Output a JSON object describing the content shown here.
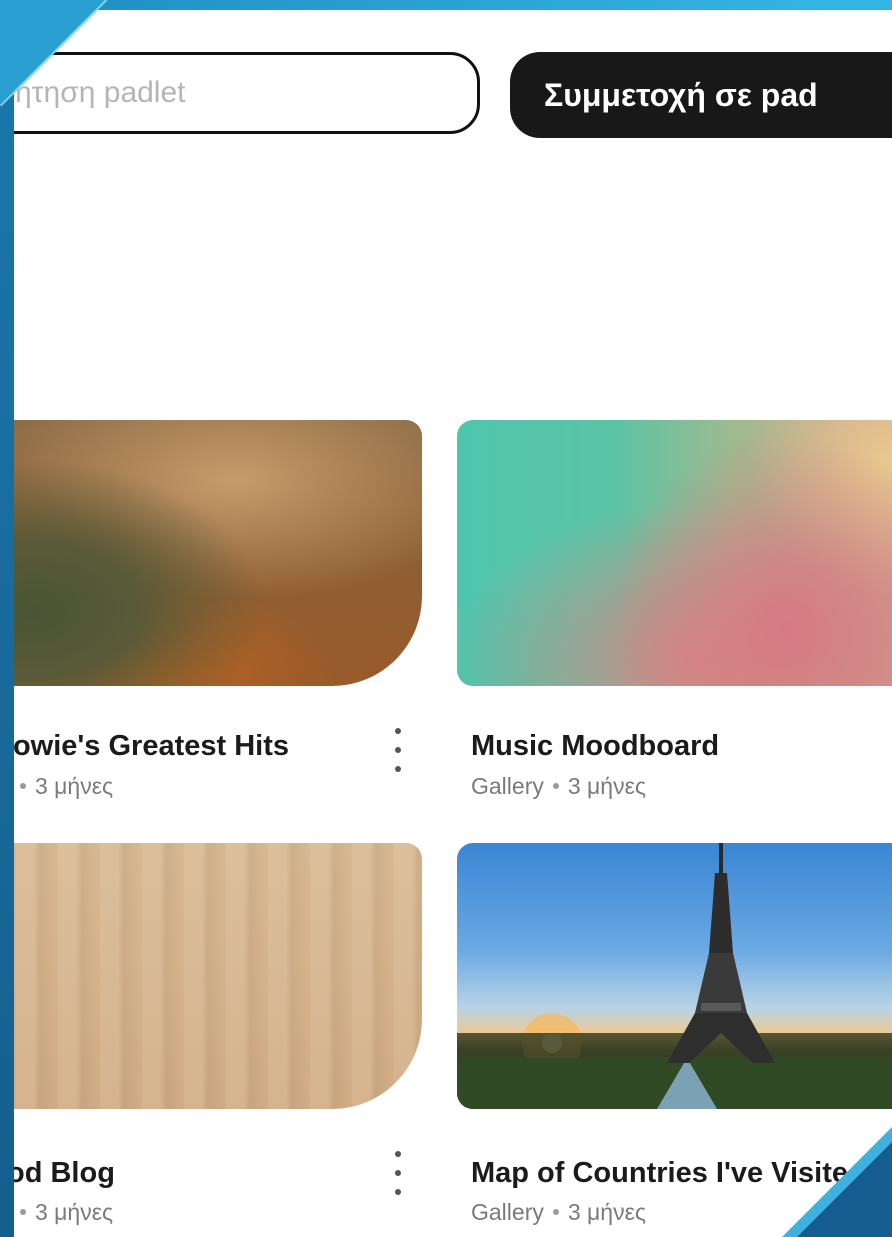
{
  "search": {
    "placeholder": "ήτηση padlet"
  },
  "join_button": {
    "label": "Συμμετοχή σε pad"
  },
  "cards": [
    {
      "title": "Bowie's Greatest Hits",
      "meta_type": "",
      "meta_age": "3 μήνες"
    },
    {
      "title": "Music Moodboard",
      "meta_type": "Gallery",
      "meta_age": "3 μήνες"
    },
    {
      "title": "od Blog",
      "meta_type": "",
      "meta_age": "3 μήνες"
    },
    {
      "title": "Map of Countries I've Visite",
      "meta_type": "Gallery",
      "meta_age": "3 μήνες"
    }
  ],
  "colors": {
    "accent_dark": "#181818",
    "frame_blue": "#2aa3d3"
  }
}
